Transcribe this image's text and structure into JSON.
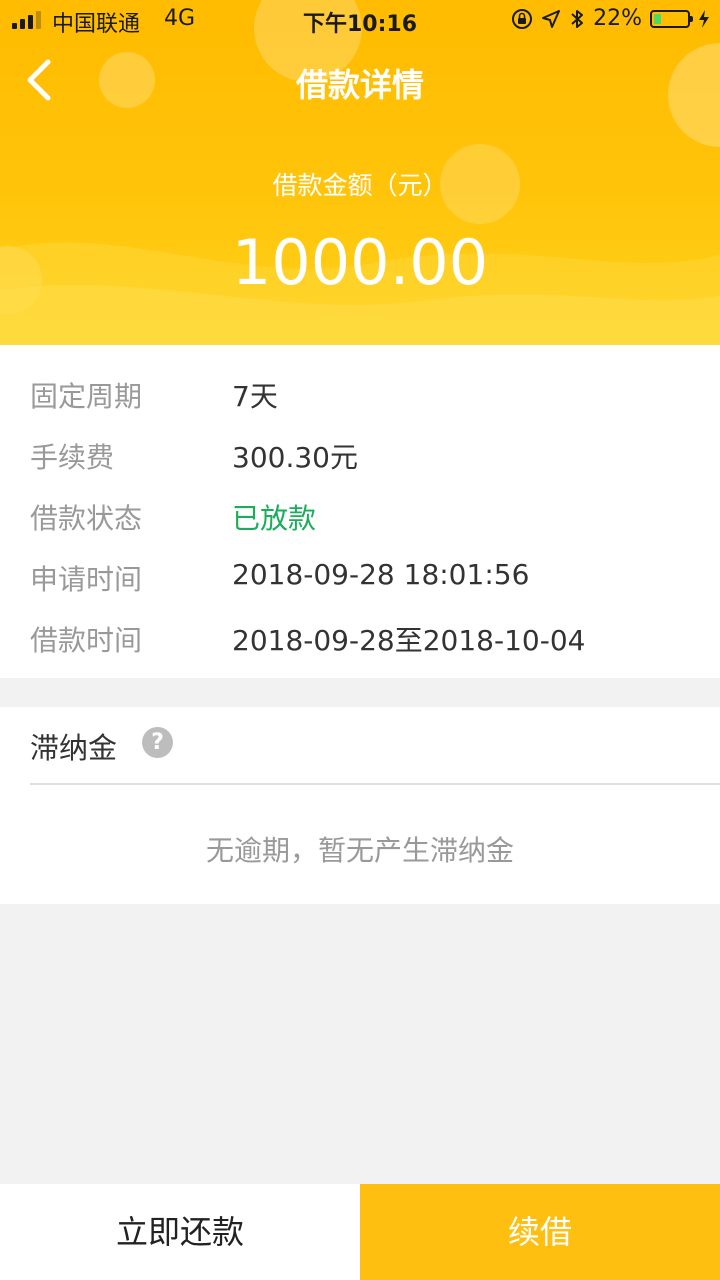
{
  "status_bar": {
    "carrier": "中国联通",
    "network": "4G",
    "time": "下午10:16",
    "battery_text": "22%",
    "battery_level": 0.22,
    "icons": [
      "signal-icon",
      "orientation-lock-icon",
      "location-icon",
      "bluetooth-icon",
      "battery-icon",
      "charging-icon"
    ]
  },
  "nav": {
    "title": "借款详情",
    "back_icon": "chevron-left-icon"
  },
  "summary": {
    "amount_label": "借款金额（元）",
    "amount": "1000.00"
  },
  "details": [
    {
      "label": "固定周期",
      "value": "7天"
    },
    {
      "label": "手续费",
      "value": "300.30元"
    },
    {
      "label": "借款状态",
      "value": "已放款"
    },
    {
      "label": "申请时间",
      "value": "2018-09-28 18:01:56"
    },
    {
      "label": "借款时间",
      "value": "2018-09-28至2018-10-04"
    }
  ],
  "late_fee": {
    "title": "滞纳金",
    "help_glyph": "?",
    "note": "无逾期，暂无产生滞纳金"
  },
  "actions": {
    "repay_label": "立即还款",
    "renew_label": "续借"
  },
  "colors": {
    "brand": "#ffbf10",
    "status_green": "#1aad5a"
  }
}
